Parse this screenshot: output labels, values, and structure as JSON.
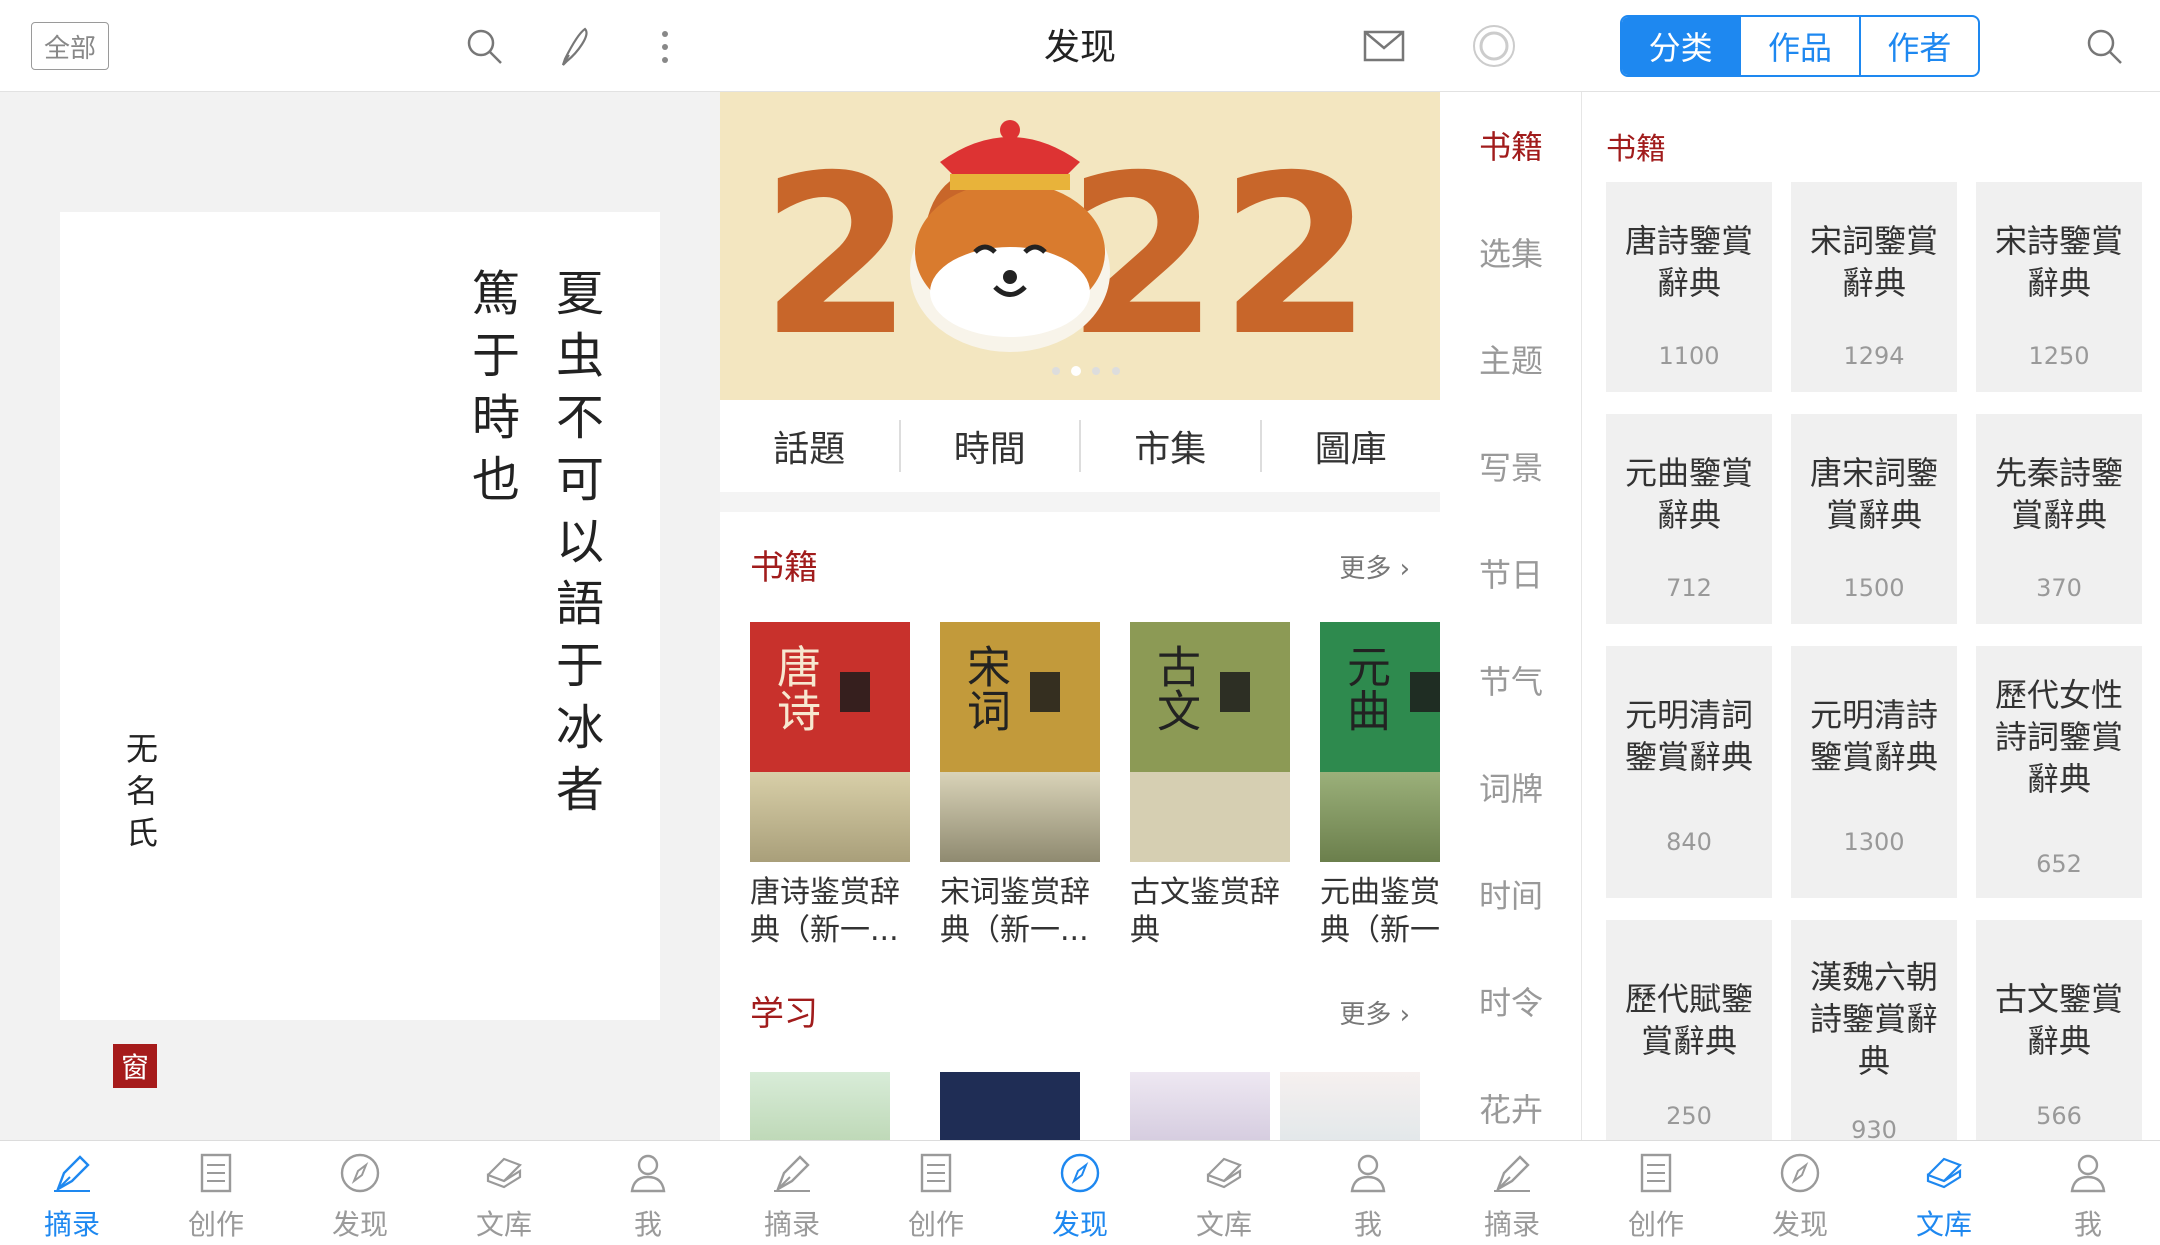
{
  "topbar": {
    "all_label": "全部",
    "title": "发现",
    "segments": [
      "分类",
      "作品",
      "作者"
    ],
    "icons": [
      "search-icon",
      "pen-icon",
      "more-vertical-icon",
      "mail-icon",
      "loading-icon",
      "search-icon"
    ]
  },
  "quote": {
    "col1": "夏虫不可以語于冰者",
    "col2": "篤于時也",
    "author": "无名氏",
    "seal": "窗"
  },
  "discover": {
    "tabs": [
      "話題",
      "時間",
      "市集",
      "圖庫"
    ],
    "books_section": {
      "title": "书籍",
      "more": "更多 ›"
    },
    "books": [
      {
        "cover": "唐诗",
        "title": "唐诗鉴赏辞典（新一..."
      },
      {
        "cover": "宋词",
        "title": "宋词鉴赏辞典（新一..."
      },
      {
        "cover": "古文",
        "title": "古文鉴赏辞典"
      },
      {
        "cover": "元曲",
        "title": "元曲鉴赏辞典（新一"
      }
    ],
    "study_section": {
      "title": "学习",
      "more": "更多 ›"
    }
  },
  "categories": [
    "书籍",
    "选集",
    "主题",
    "写景",
    "节日",
    "节气",
    "词牌",
    "时间",
    "时令",
    "花卉"
  ],
  "library": {
    "header": "书籍",
    "tiles": [
      {
        "name": "唐詩鑒賞辭典",
        "count": "1100"
      },
      {
        "name": "宋詞鑒賞辭典",
        "count": "1294"
      },
      {
        "name": "宋詩鑒賞辭典",
        "count": "1250"
      },
      {
        "name": "元曲鑒賞辭典",
        "count": "712"
      },
      {
        "name": "唐宋詞鑒賞辭典",
        "count": "1500"
      },
      {
        "name": "先秦詩鑒賞辭典",
        "count": "370"
      },
      {
        "name": "元明清詞鑒賞辭典",
        "count": "840"
      },
      {
        "name": "元明清詩鑒賞辭典",
        "count": "1300"
      },
      {
        "name": "歷代女性詩詞鑒賞辭典",
        "count": "652"
      },
      {
        "name": "歷代賦鑒賞辭典",
        "count": "250"
      },
      {
        "name": "漢魏六朝詩鑒賞辭典",
        "count": "930"
      },
      {
        "name": "古文鑒賞辭典",
        "count": "566"
      }
    ]
  },
  "bottom_tabs": [
    {
      "label": "摘录",
      "icon": "pen-nib-icon",
      "active": true
    },
    {
      "label": "创作",
      "icon": "document-icon",
      "active": false
    },
    {
      "label": "发现",
      "icon": "compass-icon",
      "active": false
    },
    {
      "label": "文库",
      "icon": "books-icon",
      "active": false
    },
    {
      "label": "我",
      "icon": "person-icon",
      "active": false
    },
    {
      "label": "摘录",
      "icon": "pen-nib-icon",
      "active": false
    },
    {
      "label": "创作",
      "icon": "document-icon",
      "active": false
    },
    {
      "label": "发现",
      "icon": "compass-icon",
      "active": true
    },
    {
      "label": "文库",
      "icon": "books-icon",
      "active": false
    },
    {
      "label": "我",
      "icon": "person-icon",
      "active": false
    },
    {
      "label": "摘录",
      "icon": "pen-nib-icon",
      "active": false
    },
    {
      "label": "创作",
      "icon": "document-icon",
      "active": false
    },
    {
      "label": "发现",
      "icon": "compass-icon",
      "active": false
    },
    {
      "label": "文库",
      "icon": "books-icon",
      "active": true
    },
    {
      "label": "我",
      "icon": "person-icon",
      "active": false
    }
  ],
  "banner_text": "2022",
  "colors": {
    "accent": "#1e88f0",
    "red": "#a11c1c",
    "tiger_orange": "#c8662a"
  }
}
